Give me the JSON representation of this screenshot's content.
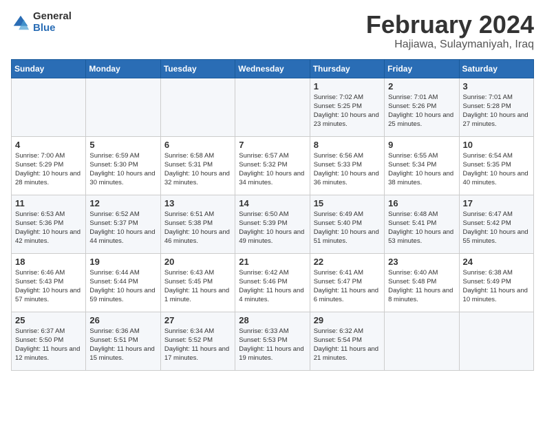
{
  "logo": {
    "general": "General",
    "blue": "Blue"
  },
  "header": {
    "month": "February 2024",
    "location": "Hajiawa, Sulaymaniyah, Iraq"
  },
  "weekdays": [
    "Sunday",
    "Monday",
    "Tuesday",
    "Wednesday",
    "Thursday",
    "Friday",
    "Saturday"
  ],
  "weeks": [
    [
      {
        "day": "",
        "sunrise": "",
        "sunset": "",
        "daylight": ""
      },
      {
        "day": "",
        "sunrise": "",
        "sunset": "",
        "daylight": ""
      },
      {
        "day": "",
        "sunrise": "",
        "sunset": "",
        "daylight": ""
      },
      {
        "day": "",
        "sunrise": "",
        "sunset": "",
        "daylight": ""
      },
      {
        "day": "1",
        "sunrise": "Sunrise: 7:02 AM",
        "sunset": "Sunset: 5:25 PM",
        "daylight": "Daylight: 10 hours and 23 minutes."
      },
      {
        "day": "2",
        "sunrise": "Sunrise: 7:01 AM",
        "sunset": "Sunset: 5:26 PM",
        "daylight": "Daylight: 10 hours and 25 minutes."
      },
      {
        "day": "3",
        "sunrise": "Sunrise: 7:01 AM",
        "sunset": "Sunset: 5:28 PM",
        "daylight": "Daylight: 10 hours and 27 minutes."
      }
    ],
    [
      {
        "day": "4",
        "sunrise": "Sunrise: 7:00 AM",
        "sunset": "Sunset: 5:29 PM",
        "daylight": "Daylight: 10 hours and 28 minutes."
      },
      {
        "day": "5",
        "sunrise": "Sunrise: 6:59 AM",
        "sunset": "Sunset: 5:30 PM",
        "daylight": "Daylight: 10 hours and 30 minutes."
      },
      {
        "day": "6",
        "sunrise": "Sunrise: 6:58 AM",
        "sunset": "Sunset: 5:31 PM",
        "daylight": "Daylight: 10 hours and 32 minutes."
      },
      {
        "day": "7",
        "sunrise": "Sunrise: 6:57 AM",
        "sunset": "Sunset: 5:32 PM",
        "daylight": "Daylight: 10 hours and 34 minutes."
      },
      {
        "day": "8",
        "sunrise": "Sunrise: 6:56 AM",
        "sunset": "Sunset: 5:33 PM",
        "daylight": "Daylight: 10 hours and 36 minutes."
      },
      {
        "day": "9",
        "sunrise": "Sunrise: 6:55 AM",
        "sunset": "Sunset: 5:34 PM",
        "daylight": "Daylight: 10 hours and 38 minutes."
      },
      {
        "day": "10",
        "sunrise": "Sunrise: 6:54 AM",
        "sunset": "Sunset: 5:35 PM",
        "daylight": "Daylight: 10 hours and 40 minutes."
      }
    ],
    [
      {
        "day": "11",
        "sunrise": "Sunrise: 6:53 AM",
        "sunset": "Sunset: 5:36 PM",
        "daylight": "Daylight: 10 hours and 42 minutes."
      },
      {
        "day": "12",
        "sunrise": "Sunrise: 6:52 AM",
        "sunset": "Sunset: 5:37 PM",
        "daylight": "Daylight: 10 hours and 44 minutes."
      },
      {
        "day": "13",
        "sunrise": "Sunrise: 6:51 AM",
        "sunset": "Sunset: 5:38 PM",
        "daylight": "Daylight: 10 hours and 46 minutes."
      },
      {
        "day": "14",
        "sunrise": "Sunrise: 6:50 AM",
        "sunset": "Sunset: 5:39 PM",
        "daylight": "Daylight: 10 hours and 49 minutes."
      },
      {
        "day": "15",
        "sunrise": "Sunrise: 6:49 AM",
        "sunset": "Sunset: 5:40 PM",
        "daylight": "Daylight: 10 hours and 51 minutes."
      },
      {
        "day": "16",
        "sunrise": "Sunrise: 6:48 AM",
        "sunset": "Sunset: 5:41 PM",
        "daylight": "Daylight: 10 hours and 53 minutes."
      },
      {
        "day": "17",
        "sunrise": "Sunrise: 6:47 AM",
        "sunset": "Sunset: 5:42 PM",
        "daylight": "Daylight: 10 hours and 55 minutes."
      }
    ],
    [
      {
        "day": "18",
        "sunrise": "Sunrise: 6:46 AM",
        "sunset": "Sunset: 5:43 PM",
        "daylight": "Daylight: 10 hours and 57 minutes."
      },
      {
        "day": "19",
        "sunrise": "Sunrise: 6:44 AM",
        "sunset": "Sunset: 5:44 PM",
        "daylight": "Daylight: 10 hours and 59 minutes."
      },
      {
        "day": "20",
        "sunrise": "Sunrise: 6:43 AM",
        "sunset": "Sunset: 5:45 PM",
        "daylight": "Daylight: 11 hours and 1 minute."
      },
      {
        "day": "21",
        "sunrise": "Sunrise: 6:42 AM",
        "sunset": "Sunset: 5:46 PM",
        "daylight": "Daylight: 11 hours and 4 minutes."
      },
      {
        "day": "22",
        "sunrise": "Sunrise: 6:41 AM",
        "sunset": "Sunset: 5:47 PM",
        "daylight": "Daylight: 11 hours and 6 minutes."
      },
      {
        "day": "23",
        "sunrise": "Sunrise: 6:40 AM",
        "sunset": "Sunset: 5:48 PM",
        "daylight": "Daylight: 11 hours and 8 minutes."
      },
      {
        "day": "24",
        "sunrise": "Sunrise: 6:38 AM",
        "sunset": "Sunset: 5:49 PM",
        "daylight": "Daylight: 11 hours and 10 minutes."
      }
    ],
    [
      {
        "day": "25",
        "sunrise": "Sunrise: 6:37 AM",
        "sunset": "Sunset: 5:50 PM",
        "daylight": "Daylight: 11 hours and 12 minutes."
      },
      {
        "day": "26",
        "sunrise": "Sunrise: 6:36 AM",
        "sunset": "Sunset: 5:51 PM",
        "daylight": "Daylight: 11 hours and 15 minutes."
      },
      {
        "day": "27",
        "sunrise": "Sunrise: 6:34 AM",
        "sunset": "Sunset: 5:52 PM",
        "daylight": "Daylight: 11 hours and 17 minutes."
      },
      {
        "day": "28",
        "sunrise": "Sunrise: 6:33 AM",
        "sunset": "Sunset: 5:53 PM",
        "daylight": "Daylight: 11 hours and 19 minutes."
      },
      {
        "day": "29",
        "sunrise": "Sunrise: 6:32 AM",
        "sunset": "Sunset: 5:54 PM",
        "daylight": "Daylight: 11 hours and 21 minutes."
      },
      {
        "day": "",
        "sunrise": "",
        "sunset": "",
        "daylight": ""
      },
      {
        "day": "",
        "sunrise": "",
        "sunset": "",
        "daylight": ""
      }
    ]
  ]
}
